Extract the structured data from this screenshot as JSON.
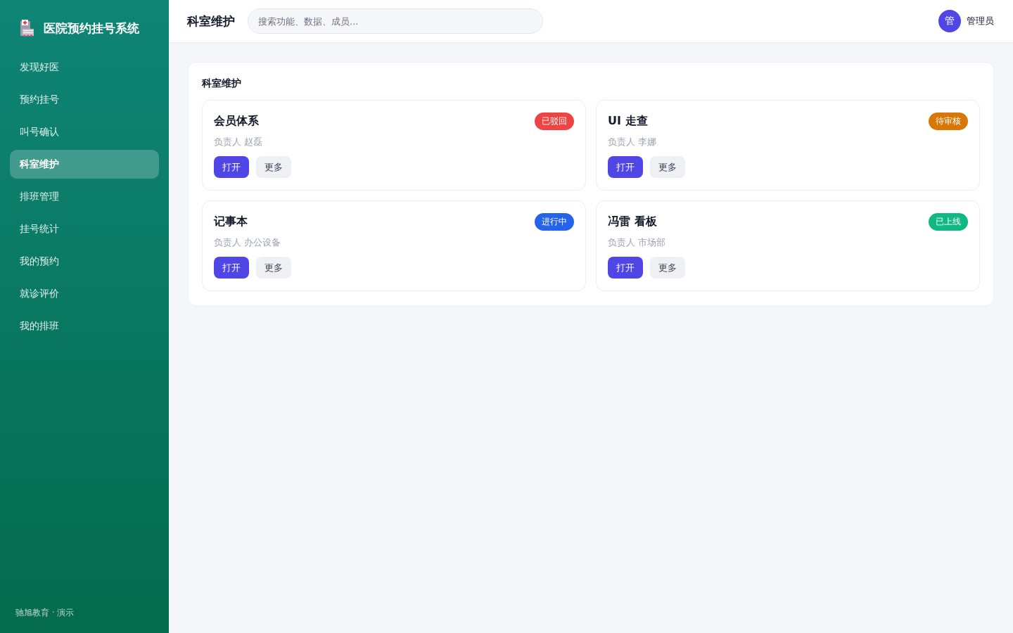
{
  "sidebar": {
    "logo_title": "医院预约挂号系统",
    "items": [
      {
        "label": "发现好医",
        "selected": false
      },
      {
        "label": "预约挂号",
        "selected": false
      },
      {
        "label": "叫号确认",
        "selected": false
      },
      {
        "label": "科室维护",
        "selected": true
      },
      {
        "label": "排班管理",
        "selected": false
      },
      {
        "label": "挂号统计",
        "selected": false
      },
      {
        "label": "我的预约",
        "selected": false
      },
      {
        "label": "就诊评价",
        "selected": false
      },
      {
        "label": "我的排班",
        "selected": false
      }
    ],
    "footer": "驰旭教育 · 演示"
  },
  "header": {
    "title": "科室维护",
    "search": {
      "placeholder": "搜索功能、数据、成员..."
    },
    "user": {
      "avatar": "管",
      "name": "管理员"
    }
  },
  "panel": {
    "title": "科室维护",
    "cards": [
      {
        "title": "会员体系",
        "owner": "负责人 赵磊",
        "status": {
          "label": "已驳回",
          "color": "#ef4444"
        },
        "buttons": [
          {
            "label": "打开",
            "kind": "primary"
          },
          {
            "label": "更多",
            "kind": "secondary"
          }
        ]
      },
      {
        "title": "UI 走查",
        "owner": "负责人 李娜",
        "status": {
          "label": "待审核",
          "color": "#d97706"
        },
        "buttons": [
          {
            "label": "打开",
            "kind": "primary"
          },
          {
            "label": "更多",
            "kind": "secondary"
          }
        ]
      },
      {
        "title": "记事本",
        "owner": "负责人 办公设备",
        "status": {
          "label": "进行中",
          "color": "#2563eb"
        },
        "buttons": [
          {
            "label": "打开",
            "kind": "primary"
          },
          {
            "label": "更多",
            "kind": "secondary"
          }
        ]
      },
      {
        "title": "冯雷 看板",
        "owner": "负责人 市场部",
        "status": {
          "label": "已上线",
          "color": "#10b981"
        },
        "buttons": [
          {
            "label": "打开",
            "kind": "primary"
          },
          {
            "label": "更多",
            "kind": "secondary"
          }
        ]
      }
    ]
  }
}
